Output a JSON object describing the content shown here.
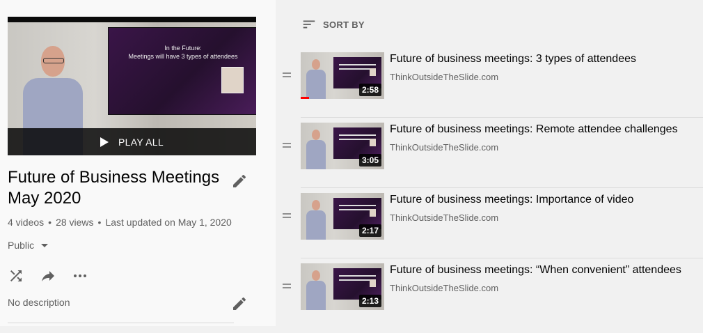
{
  "playlist": {
    "title": "Future of Business Meetings May 2020",
    "play_all_label": "PLAY ALL",
    "slide_line1": "In the Future:",
    "slide_line2": "Meetings will have 3 types of attendees",
    "stats": {
      "videos": "4 videos",
      "views": "28 views",
      "updated": "Last updated on May 1, 2020"
    },
    "privacy": "Public",
    "description": "No description"
  },
  "sort": {
    "label": "SORT BY"
  },
  "videos": [
    {
      "title": "Future of business meetings: 3 types of attendees",
      "channel": "ThinkOutsideTheSlide.com",
      "duration": "2:58",
      "watched_fraction": 0.1
    },
    {
      "title": "Future of business meetings: Remote attendee challenges",
      "channel": "ThinkOutsideTheSlide.com",
      "duration": "3:05",
      "watched_fraction": 0
    },
    {
      "title": "Future of business meetings: Importance of video",
      "channel": "ThinkOutsideTheSlide.com",
      "duration": "2:17",
      "watched_fraction": 0
    },
    {
      "title": "Future of business meetings: “When convenient” attendees",
      "channel": "ThinkOutsideTheSlide.com",
      "duration": "2:13",
      "watched_fraction": 0
    }
  ],
  "icons": {
    "edit": "pencil-icon",
    "shuffle": "shuffle-icon",
    "share": "share-icon",
    "more": "more-horiz-icon",
    "sort": "sort-icon",
    "drag": "drag-handle-icon",
    "play": "play-icon"
  }
}
